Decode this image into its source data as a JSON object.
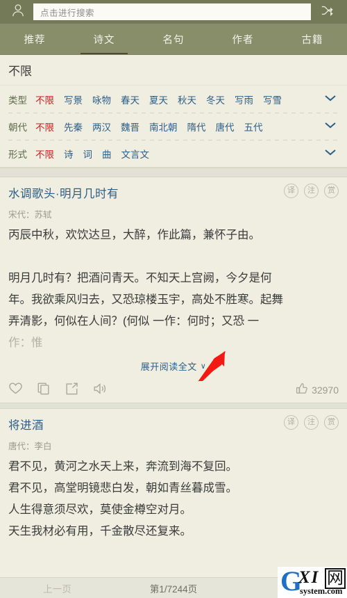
{
  "header": {
    "avatar_icon": "user-icon",
    "search_placeholder": "点击进行搜索",
    "shuffle_icon": "shuffle-icon"
  },
  "nav": {
    "tabs": [
      {
        "label": "推荐",
        "active": false
      },
      {
        "label": "诗文",
        "active": true
      },
      {
        "label": "名句",
        "active": false
      },
      {
        "label": "作者",
        "active": false
      },
      {
        "label": "古籍",
        "active": false
      }
    ]
  },
  "filter": {
    "title": "不限",
    "rows": [
      {
        "label": "类型",
        "options": [
          "不限",
          "写景",
          "咏物",
          "春天",
          "夏天",
          "秋天",
          "冬天",
          "写雨",
          "写雪"
        ],
        "selected": "不限",
        "chevron_icon": "chevron-down-icon"
      },
      {
        "label": "朝代",
        "options": [
          "不限",
          "先秦",
          "两汉",
          "魏晋",
          "南北朝",
          "隋代",
          "唐代",
          "五代"
        ],
        "selected": "不限",
        "chevron_icon": "chevron-down-icon"
      },
      {
        "label": "形式",
        "options": [
          "不限",
          "诗",
          "词",
          "曲",
          "文言文"
        ],
        "selected": "不限",
        "chevron_icon": "chevron-down-icon"
      }
    ]
  },
  "poems": [
    {
      "title": "水调歌头·明月几时有",
      "meta": "宋代：苏轼",
      "badges": [
        "译",
        "注",
        "赏"
      ],
      "lines": [
        {
          "text": "丙辰中秋，欢饮达旦，大醉，作此篇，兼怀子由。",
          "faded": false
        },
        {
          "text": "",
          "faded": false
        },
        {
          "text": "明月几时有？把酒问青天。不知天上宫阙，今夕是何",
          "faded": false
        },
        {
          "text": "年。我欲乘风归去，又恐琼楼玉宇，高处不胜寒。起舞",
          "faded": false
        },
        {
          "text": "弄清影，何似在人间？(何似 一作：何时；又恐 一",
          "faded": false
        },
        {
          "text": "作：惟",
          "faded": true
        }
      ],
      "expand_label": "展开阅读全文",
      "expand_chevron": "∨",
      "actions": [
        "heart-icon",
        "copy-icon",
        "share-icon",
        "speaker-icon"
      ],
      "like_icon": "thumbs-up-icon",
      "like_count": "32970"
    },
    {
      "title": "将进酒",
      "meta": "唐代：李白",
      "badges": [
        "译",
        "注",
        "赏"
      ],
      "lines": [
        {
          "text": "君不见，黄河之水天上来，奔流到海不复回。",
          "faded": false
        },
        {
          "text": "君不见，高堂明镜悲白发，朝如青丝暮成雪。",
          "faded": false
        },
        {
          "text": "人生得意须尽欢，莫使金樽空对月。",
          "faded": false
        },
        {
          "text": "天生我材必有用，千金散尽还复来。",
          "faded": false
        }
      ]
    }
  ],
  "bottom_bar": {
    "prev_label": "上一页",
    "page_label": "第1/7244页"
  },
  "watermark": {
    "g": "G",
    "xi": "XI",
    "wang": "网",
    "system": "system.com"
  },
  "colors": {
    "header_bg": "#747a58",
    "nav_bg": "#888e6a",
    "page_bg": "#efeee1",
    "link_blue": "#2d5e87",
    "selected_red": "#cc1d1d",
    "label_green": "#5f6b4a",
    "arrow_red": "#f41a14"
  }
}
